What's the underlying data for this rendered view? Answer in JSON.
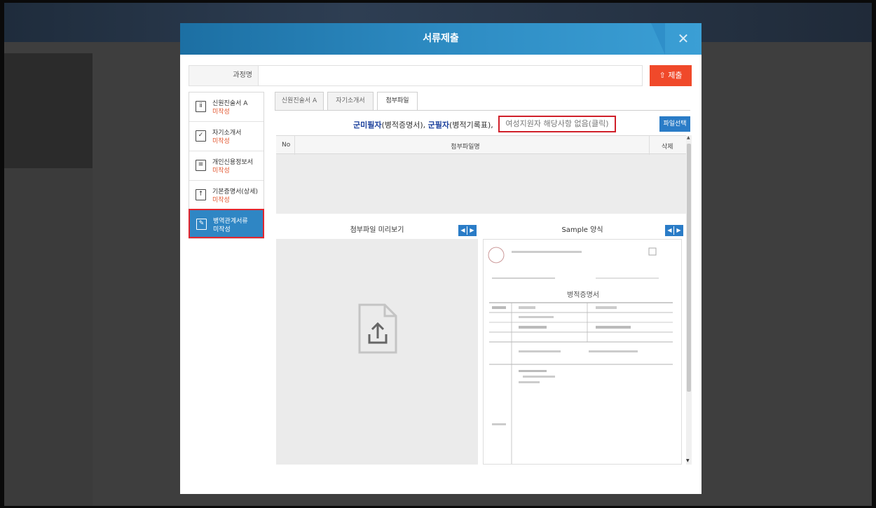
{
  "modal": {
    "title": "서류제출",
    "close_icon": "close-icon"
  },
  "course": {
    "label": "과정명",
    "value": "",
    "submit_label": "제출"
  },
  "documents": [
    {
      "name": "신원진술서 A",
      "status": "미작성",
      "icon": "document-icon"
    },
    {
      "name": "자기소개서",
      "status": "미작성",
      "icon": "checkbox-icon"
    },
    {
      "name": "개인신용정보서",
      "status": "미작성",
      "icon": "list-document-icon"
    },
    {
      "name": "기본증명서(상세)",
      "status": "미작성",
      "icon": "upload-icon"
    },
    {
      "name": "병역관계서류",
      "status": "미작성",
      "icon": "edit-icon"
    }
  ],
  "tabs": [
    "신원진술서 A",
    "자기소개서",
    "첨부파일"
  ],
  "notice": {
    "part1_bold": "군미필자",
    "part1": "(병적증명서),",
    "part2_bold": "군필자",
    "part2": "(병적기록표),",
    "female_button": "여성지원자 해당사항 없음(클릭)",
    "file_select_button": "파일선택"
  },
  "file_table": {
    "headers": [
      "No",
      "첨부파일명",
      "삭제"
    ],
    "rows": []
  },
  "preview": {
    "title": "첨부파일 미리보기",
    "icon": "file-upload-icon"
  },
  "sample": {
    "title": "Sample 양식",
    "doc_title": "병적증명서"
  },
  "colors": {
    "header_blue": "#2d8bc2",
    "submit_red": "#f0492a",
    "active_item_blue": "#2f86c4",
    "highlight_red": "#d0202a",
    "notice_blue": "#1a3f9b"
  }
}
